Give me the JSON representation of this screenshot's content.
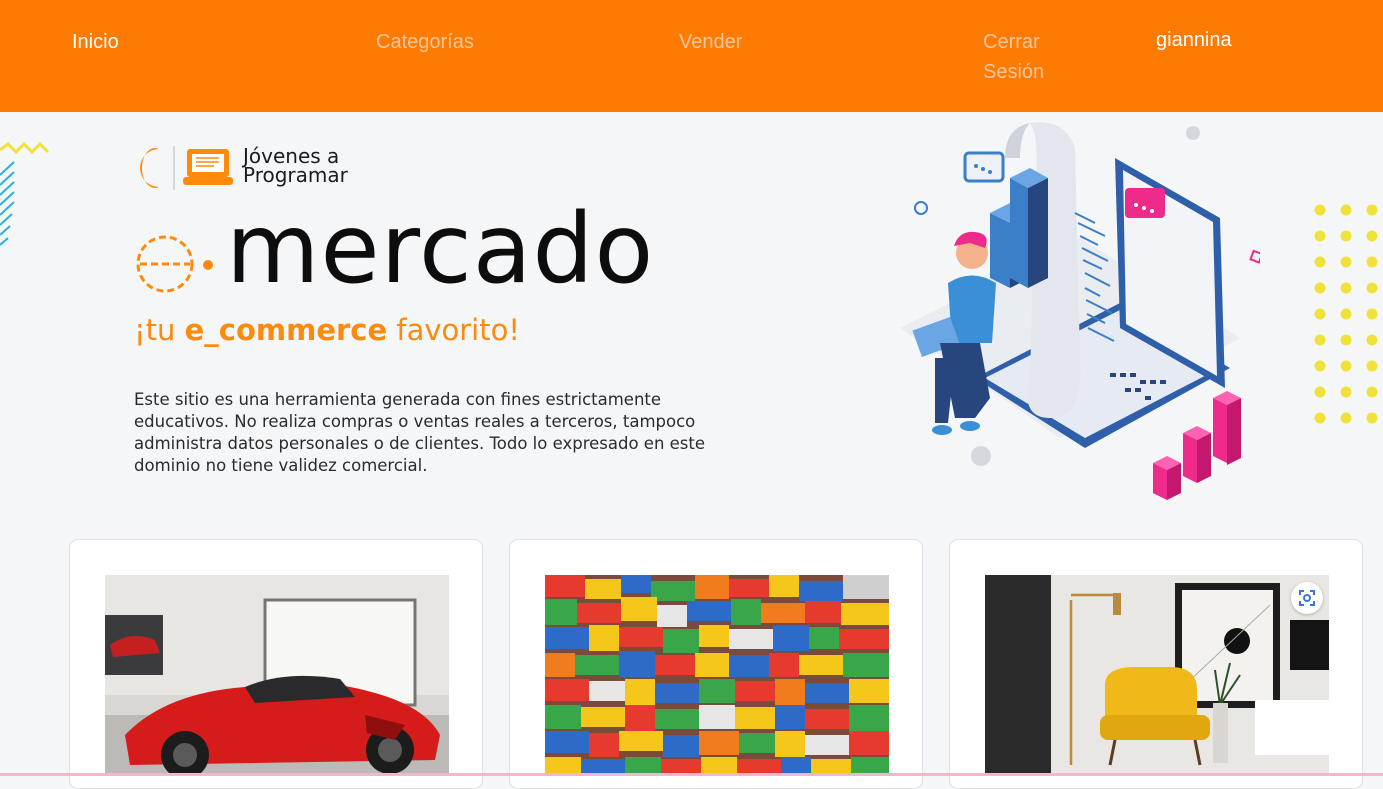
{
  "nav": {
    "home": "Inicio",
    "categories": "Categorías",
    "sell": "Vender",
    "logout": "Cerrar Sesión",
    "user": "giannina"
  },
  "logo": {
    "line1": "Jóvenes a",
    "line2": "Programar"
  },
  "hero": {
    "brand_prefix": "e",
    "brand_word": "mercado",
    "tagline_pre": "¡tu ",
    "tagline_bold": "e_commerce",
    "tagline_post": " favorito!",
    "description": "Este sitio es una herramienta generada con fines estrictamente educativos. No realiza compras o ventas reales a terceros, tampoco administra datos personales o de clientes. Todo lo expresado en este dominio no tiene validez comercial."
  },
  "colors": {
    "accent": "#fe7b03",
    "tagline": "#fc8a0c",
    "pink": "#ee2a8a",
    "blue": "#3a7fc8",
    "yellow": "#f1e23a"
  },
  "cards": [
    {
      "image": "red sports car in garage"
    },
    {
      "image": "colorful plastic building bricks"
    },
    {
      "image": "yellow armchair in living room"
    }
  ],
  "icons": {
    "lens": "visual-search-icon"
  }
}
